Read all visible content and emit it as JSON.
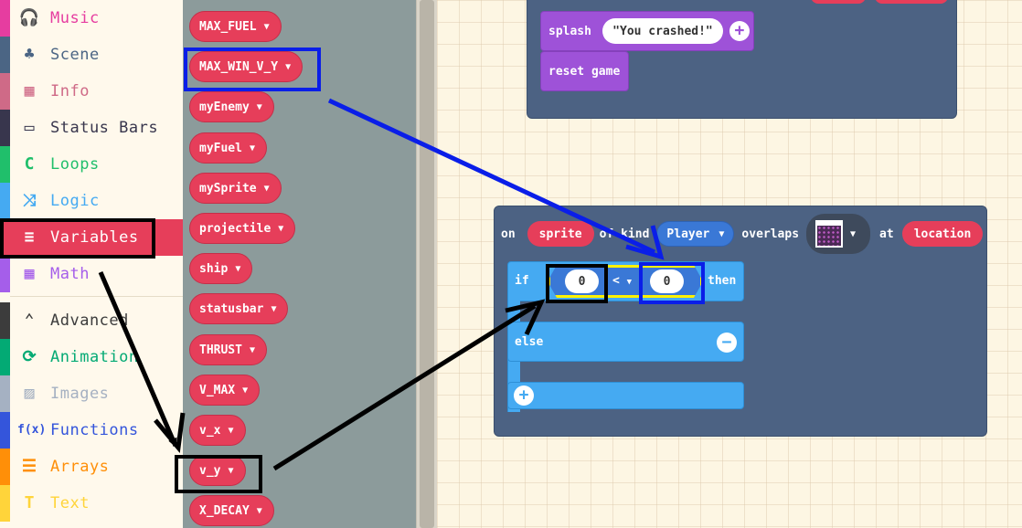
{
  "sidebar": {
    "categories": [
      {
        "label": "Music",
        "icon": "🎧",
        "color": "#e63da0"
      },
      {
        "label": "Scene",
        "icon": "♣",
        "color": "#4b6584"
      },
      {
        "label": "Info",
        "icon": "▦",
        "color": "#cf6a87"
      },
      {
        "label": "Status Bars",
        "icon": "▭",
        "color": "#38364d"
      },
      {
        "label": "Loops",
        "icon": "C",
        "color": "#20bf6b"
      },
      {
        "label": "Logic",
        "icon": "⤨",
        "color": "#45aaf2"
      },
      {
        "label": "Variables",
        "icon": "≡",
        "color": "#e63e5a",
        "selected": true
      },
      {
        "label": "Math",
        "icon": "▦",
        "color": "#a55eea"
      },
      {
        "label": "Advanced",
        "icon": "⌃",
        "color": "#3c3c3c"
      },
      {
        "label": "Animation",
        "icon": "⟳",
        "color": "#03aa74"
      },
      {
        "label": "Images",
        "icon": "▨",
        "color": "#a5b1c2"
      },
      {
        "label": "Functions",
        "icon": "f(x)",
        "color": "#3455db"
      },
      {
        "label": "Arrays",
        "icon": "☰",
        "color": "#ff8f08"
      },
      {
        "label": "Text",
        "icon": "T",
        "color": "#ffd43a"
      }
    ]
  },
  "flyout": {
    "variables": [
      "MAX_FUEL",
      "MAX_WIN_V_Y",
      "myEnemy",
      "myFuel",
      "mySprite",
      "projectile",
      "ship",
      "statusbar",
      "THRUST",
      "V_MAX",
      "v_x",
      "v_y",
      "X_DECAY"
    ],
    "caret": "▼"
  },
  "workspace": {
    "splash_keyword": "splash",
    "splash_text": "\"You crashed!\"",
    "reset_label": "reset game",
    "overlap": {
      "on": "on",
      "sprite": "sprite",
      "of_kind": "of kind",
      "kind_value": "Player",
      "overlaps": "overlaps",
      "at": "at",
      "location": "location"
    },
    "if_label": "if",
    "left_value": "0",
    "operator": "<",
    "right_value": "0",
    "then_label": "then",
    "else_label": "else",
    "plus": "+",
    "minus": "−"
  },
  "annotations": {
    "black": "#000000",
    "blue": "#0a1ee8"
  }
}
